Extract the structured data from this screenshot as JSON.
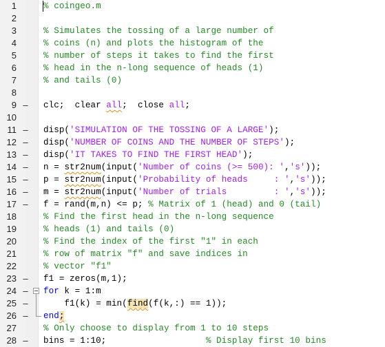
{
  "editor": {
    "filename_comment": "% coingeo.m",
    "lines": [
      {
        "n": "1",
        "exec": false,
        "segments": [
          {
            "t": "% coingeo.m",
            "c": "c"
          }
        ]
      },
      {
        "n": "2",
        "exec": false,
        "segments": []
      },
      {
        "n": "3",
        "exec": false,
        "segments": [
          {
            "t": "% Simulates the tossing of a large number of",
            "c": "c"
          }
        ]
      },
      {
        "n": "4",
        "exec": false,
        "segments": [
          {
            "t": "% coins (n) and plots the histogram of the",
            "c": "c"
          }
        ]
      },
      {
        "n": "5",
        "exec": false,
        "segments": [
          {
            "t": "% number of steps it takes to find the first",
            "c": "c"
          }
        ]
      },
      {
        "n": "6",
        "exec": false,
        "segments": [
          {
            "t": "% head in the n-long sequence of heads (1)",
            "c": "c"
          }
        ]
      },
      {
        "n": "7",
        "exec": false,
        "segments": [
          {
            "t": "% and tails (0)",
            "c": "c"
          }
        ]
      },
      {
        "n": "8",
        "exec": false,
        "segments": []
      },
      {
        "n": "9",
        "exec": true,
        "segments": [
          {
            "t": "clc;  clear "
          },
          {
            "t": "all",
            "c": "s sq"
          },
          {
            "t": ";  close "
          },
          {
            "t": "all",
            "c": "s"
          },
          {
            "t": ";"
          }
        ]
      },
      {
        "n": "10",
        "exec": false,
        "segments": []
      },
      {
        "n": "11",
        "exec": true,
        "segments": [
          {
            "t": "disp("
          },
          {
            "t": "'SIMULATION OF THE TOSSING OF A LARGE'",
            "c": "s"
          },
          {
            "t": ");"
          }
        ]
      },
      {
        "n": "12",
        "exec": true,
        "segments": [
          {
            "t": "disp("
          },
          {
            "t": "'NUMBER OF COINS AND THE NUMBER OF STEPS'",
            "c": "s"
          },
          {
            "t": ");"
          }
        ]
      },
      {
        "n": "13",
        "exec": true,
        "segments": [
          {
            "t": "disp("
          },
          {
            "t": "'IT TAKES TO FIND THE FIRST HEAD'",
            "c": "s"
          },
          {
            "t": ");"
          }
        ]
      },
      {
        "n": "14",
        "exec": true,
        "segments": [
          {
            "t": "n = "
          },
          {
            "t": "str2num",
            "c": "sq"
          },
          {
            "t": "(input("
          },
          {
            "t": "'Number of coins (>= 500): '",
            "c": "s"
          },
          {
            "t": ","
          },
          {
            "t": "'s'",
            "c": "s"
          },
          {
            "t": "));"
          }
        ]
      },
      {
        "n": "15",
        "exec": true,
        "segments": [
          {
            "t": "p = "
          },
          {
            "t": "str2num",
            "c": "sq"
          },
          {
            "t": "(input("
          },
          {
            "t": "'Probability of heads     : '",
            "c": "s"
          },
          {
            "t": ","
          },
          {
            "t": "'s'",
            "c": "s"
          },
          {
            "t": "));"
          }
        ]
      },
      {
        "n": "16",
        "exec": true,
        "segments": [
          {
            "t": "m = "
          },
          {
            "t": "str2num",
            "c": "sq"
          },
          {
            "t": "(input("
          },
          {
            "t": "'Number of trials         : '",
            "c": "s"
          },
          {
            "t": ","
          },
          {
            "t": "'s'",
            "c": "s"
          },
          {
            "t": "));"
          }
        ]
      },
      {
        "n": "17",
        "exec": true,
        "segments": [
          {
            "t": "f = rand(m,n) <= p; "
          },
          {
            "t": "% Matrix of 1 (head) and 0 (tail)",
            "c": "c"
          }
        ]
      },
      {
        "n": "18",
        "exec": false,
        "segments": [
          {
            "t": "% Find the first head in the n-long sequence",
            "c": "c"
          }
        ]
      },
      {
        "n": "19",
        "exec": false,
        "segments": [
          {
            "t": "% heads (1) and tails (0)",
            "c": "c"
          }
        ]
      },
      {
        "n": "20",
        "exec": false,
        "segments": [
          {
            "t": "% Find the index of the first \"1\" in each",
            "c": "c"
          }
        ]
      },
      {
        "n": "21",
        "exec": false,
        "segments": [
          {
            "t": "% row of matrix \"f\" and save indices in",
            "c": "c"
          }
        ]
      },
      {
        "n": "22",
        "exec": false,
        "segments": [
          {
            "t": "% vector \"f1\"",
            "c": "c"
          }
        ]
      },
      {
        "n": "23",
        "exec": true,
        "segments": [
          {
            "t": "f1 = zeros(m,1);"
          }
        ]
      },
      {
        "n": "24",
        "exec": true,
        "segments": [
          {
            "t": "for",
            "c": "k"
          },
          {
            "t": " k = 1:m"
          }
        ]
      },
      {
        "n": "25",
        "exec": true,
        "segments": [
          {
            "t": "    f1(k) = min("
          },
          {
            "t": "find",
            "c": "hl sq"
          },
          {
            "t": "(f(k,:) == 1));"
          }
        ]
      },
      {
        "n": "26",
        "exec": true,
        "segments": [
          {
            "t": "end",
            "c": "k"
          },
          {
            "t": ";",
            "c": "hl sq"
          }
        ]
      },
      {
        "n": "27",
        "exec": false,
        "segments": [
          {
            "t": "% Only choose to display from 1 to 10 steps",
            "c": "c"
          }
        ]
      },
      {
        "n": "28",
        "exec": true,
        "segments": [
          {
            "t": "bins = 1:10;                   "
          },
          {
            "t": "% Display first 10 bins",
            "c": "c"
          }
        ]
      }
    ],
    "exec_marker": "–"
  }
}
